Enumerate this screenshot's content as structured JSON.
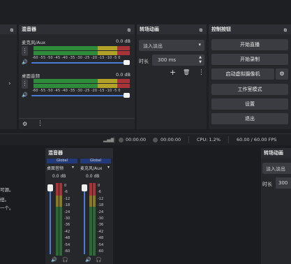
{
  "colors": {
    "accent": "#4a7bd8",
    "meter_green": "#2e8b3a",
    "meter_yellow": "#b3a22a",
    "meter_red": "#a8343a",
    "bg": "#1e1f22"
  },
  "mixer": {
    "title": "混音器",
    "channels": [
      {
        "name": "麦克风/Aux",
        "level": "0.0 dB",
        "scale": "-60  -55  -50  -45  -40  -35  -30  -25  -20  -15  -10  -5   0"
      },
      {
        "name": "桌面音频",
        "level": "0.0 dB",
        "scale": "-60  -55  -50  -45  -40  -35  -30  -25  -20  -15  -10  -5   0"
      }
    ]
  },
  "transition": {
    "title": "转场动画",
    "type": "淡入淡出",
    "duration_label": "时长",
    "duration_value": "300 ms"
  },
  "controls": {
    "title": "控制按钮",
    "buttons": [
      "开始直播",
      "开始录制",
      "启动虚拟摄像机",
      "工作室模式",
      "设置",
      "退出"
    ]
  },
  "status": {
    "time1": "00:00:00",
    "time2": "00:00:00",
    "cpu": "CPU: 1.2%",
    "fps": "60.00 / 60.00 FPS"
  },
  "bottom": {
    "mixer_title": "混音器",
    "transition_title": "转场动画",
    "transition_type": "淡入淡出",
    "duration_label": "时长",
    "duration_value": "300",
    "left_text": [
      "可源。",
      "纽。",
      "一个。"
    ],
    "channels": [
      {
        "group": "Global",
        "name": "桌面音频",
        "level": "0.0 dB"
      },
      {
        "group": "Global",
        "name": "麦克风/Aux",
        "level": "0.0 dB"
      }
    ],
    "vscale": [
      "0",
      "-6",
      "-12",
      "-18",
      "-24",
      "-30",
      "-36",
      "-42",
      "-48",
      "-54",
      "-60"
    ]
  }
}
